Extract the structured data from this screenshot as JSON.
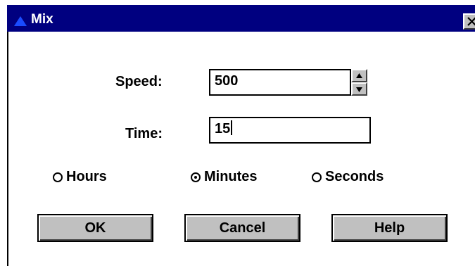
{
  "window": {
    "title": "Mix",
    "title_icon": "triangle-app-icon",
    "close_icon": "close-x-icon"
  },
  "form": {
    "speed_label": "Speed:",
    "speed_value": "500",
    "time_label": "Time:",
    "time_value": "15"
  },
  "units": {
    "options": [
      {
        "label": "Hours",
        "checked": false
      },
      {
        "label": "Minutes",
        "checked": true
      },
      {
        "label": "Seconds",
        "checked": false
      }
    ]
  },
  "buttons": {
    "ok": "OK",
    "cancel": "Cancel",
    "help": "Help"
  },
  "colors": {
    "titlebar": "#000080",
    "face": "#c0c0c0",
    "title_text": "#ffffff"
  }
}
